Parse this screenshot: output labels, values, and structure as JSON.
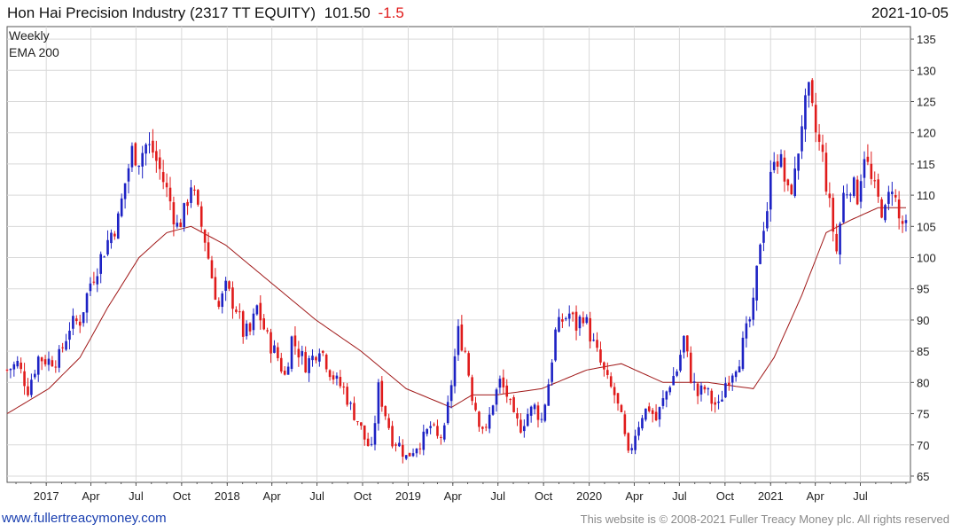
{
  "header": {
    "name": "Hon Hai Precision Industry (2317 TT EQUITY)",
    "price": "101.50",
    "change": "-1.5",
    "date": "2021-10-05"
  },
  "legend": {
    "period": "Weekly",
    "ema": "EMA 200"
  },
  "footer": {
    "link": "www.fullertreacymoney.com",
    "copyright": "This website is © 2008-2021 Fuller Treacy Money plc. All rights reserved"
  },
  "colors": {
    "up": "#1d22c4",
    "down": "#e01b1b",
    "ema": "#a01818",
    "title_name": "#111111",
    "grid": "#d9d9d9"
  },
  "chart_data": {
    "type": "candlestick",
    "interval": "weekly",
    "ylim": [
      64,
      137
    ],
    "y_ticks": [
      65,
      70,
      75,
      80,
      85,
      90,
      95,
      100,
      105,
      110,
      115,
      120,
      125,
      130,
      135
    ],
    "x_ticks": [
      {
        "label": "2017",
        "date": "2017-01-01"
      },
      {
        "label": "Apr",
        "date": "2017-04-01"
      },
      {
        "label": "Jul",
        "date": "2017-07-01"
      },
      {
        "label": "Oct",
        "date": "2017-10-01"
      },
      {
        "label": "2018",
        "date": "2018-01-01"
      },
      {
        "label": "Apr",
        "date": "2018-04-01"
      },
      {
        "label": "Jul",
        "date": "2018-07-01"
      },
      {
        "label": "Oct",
        "date": "2018-10-01"
      },
      {
        "label": "2019",
        "date": "2019-01-01"
      },
      {
        "label": "Apr",
        "date": "2019-04-01"
      },
      {
        "label": "Jul",
        "date": "2019-07-01"
      },
      {
        "label": "Oct",
        "date": "2019-10-01"
      },
      {
        "label": "2020",
        "date": "2020-01-01"
      },
      {
        "label": "Apr",
        "date": "2020-04-01"
      },
      {
        "label": "Jul",
        "date": "2020-07-01"
      },
      {
        "label": "Oct",
        "date": "2020-10-01"
      },
      {
        "label": "2021",
        "date": "2021-01-01"
      },
      {
        "label": "Apr",
        "date": "2021-04-01"
      },
      {
        "label": "Jul",
        "date": "2021-07-01"
      }
    ],
    "x_start": "2016-10-14",
    "x_end": "2021-10-10",
    "close_anchors": [
      [
        "2016-10-14",
        82
      ],
      [
        "2016-11-04",
        83
      ],
      [
        "2016-11-25",
        79
      ],
      [
        "2016-12-16",
        84
      ],
      [
        "2017-01-06",
        83.5
      ],
      [
        "2017-01-27",
        84
      ],
      [
        "2017-02-17",
        89
      ],
      [
        "2017-03-10",
        90
      ],
      [
        "2017-03-31",
        96
      ],
      [
        "2017-04-21",
        100
      ],
      [
        "2017-05-12",
        104
      ],
      [
        "2017-05-26",
        106
      ],
      [
        "2017-06-09",
        112
      ],
      [
        "2017-06-23",
        117
      ],
      [
        "2017-07-07",
        116
      ],
      [
        "2017-07-21",
        118
      ],
      [
        "2017-08-04",
        117
      ],
      [
        "2017-08-18",
        114
      ],
      [
        "2017-09-08",
        109
      ],
      [
        "2017-09-22",
        105
      ],
      [
        "2017-10-06",
        107
      ],
      [
        "2017-10-20",
        112
      ],
      [
        "2017-11-03",
        107
      ],
      [
        "2017-11-17",
        103
      ],
      [
        "2017-12-01",
        97
      ],
      [
        "2017-12-15",
        92
      ],
      [
        "2017-12-29",
        95
      ],
      [
        "2018-01-19",
        92
      ],
      [
        "2018-02-02",
        88
      ],
      [
        "2018-02-16",
        88
      ],
      [
        "2018-03-02",
        92
      ],
      [
        "2018-03-23",
        87
      ],
      [
        "2018-04-13",
        84
      ],
      [
        "2018-04-27",
        81
      ],
      [
        "2018-05-11",
        87
      ],
      [
        "2018-05-25",
        85
      ],
      [
        "2018-06-08",
        83
      ],
      [
        "2018-06-22",
        84
      ],
      [
        "2018-07-06",
        86
      ],
      [
        "2018-07-27",
        82
      ],
      [
        "2018-08-10",
        80
      ],
      [
        "2018-08-24",
        79
      ],
      [
        "2018-09-07",
        76
      ],
      [
        "2018-09-21",
        74
      ],
      [
        "2018-10-05",
        71
      ],
      [
        "2018-10-19",
        69
      ],
      [
        "2018-11-02",
        79
      ],
      [
        "2018-11-16",
        75
      ],
      [
        "2018-11-30",
        71
      ],
      [
        "2018-12-14",
        70
      ],
      [
        "2018-12-28",
        68
      ],
      [
        "2019-01-18",
        70
      ],
      [
        "2019-02-01",
        71
      ],
      [
        "2019-02-15",
        73
      ],
      [
        "2019-03-01",
        71
      ],
      [
        "2019-03-15",
        72
      ],
      [
        "2019-03-29",
        80
      ],
      [
        "2019-04-12",
        88
      ],
      [
        "2019-04-26",
        85
      ],
      [
        "2019-05-10",
        78
      ],
      [
        "2019-05-24",
        74
      ],
      [
        "2019-06-07",
        72
      ],
      [
        "2019-06-21",
        77
      ],
      [
        "2019-07-05",
        80
      ],
      [
        "2019-07-19",
        78
      ],
      [
        "2019-08-02",
        74
      ],
      [
        "2019-08-16",
        73
      ],
      [
        "2019-08-30",
        75
      ],
      [
        "2019-09-13",
        76
      ],
      [
        "2019-09-27",
        74
      ],
      [
        "2019-10-11",
        80
      ],
      [
        "2019-10-25",
        88
      ],
      [
        "2019-11-08",
        90
      ],
      [
        "2019-11-22",
        91
      ],
      [
        "2019-12-06",
        89
      ],
      [
        "2019-12-20",
        91
      ],
      [
        "2020-01-10",
        86
      ],
      [
        "2020-01-24",
        83
      ],
      [
        "2020-02-07",
        80
      ],
      [
        "2020-02-21",
        78
      ],
      [
        "2020-03-06",
        74
      ],
      [
        "2020-03-20",
        68
      ],
      [
        "2020-04-03",
        72
      ],
      [
        "2020-04-17",
        75
      ],
      [
        "2020-05-01",
        76
      ],
      [
        "2020-05-15",
        74
      ],
      [
        "2020-05-29",
        77
      ],
      [
        "2020-06-12",
        80
      ],
      [
        "2020-06-26",
        82
      ],
      [
        "2020-07-10",
        87
      ],
      [
        "2020-07-24",
        81
      ],
      [
        "2020-08-07",
        78
      ],
      [
        "2020-08-21",
        79
      ],
      [
        "2020-09-04",
        77
      ],
      [
        "2020-09-18",
        76
      ],
      [
        "2020-10-02",
        80
      ],
      [
        "2020-10-16",
        82
      ],
      [
        "2020-10-30",
        84
      ],
      [
        "2020-11-13",
        88
      ],
      [
        "2020-11-27",
        92
      ],
      [
        "2020-12-11",
        103
      ],
      [
        "2020-12-25",
        108
      ],
      [
        "2021-01-08",
        117
      ],
      [
        "2021-01-22",
        115
      ],
      [
        "2021-02-05",
        110
      ],
      [
        "2021-02-19",
        113
      ],
      [
        "2021-03-05",
        122
      ],
      [
        "2021-03-19",
        126
      ],
      [
        "2021-04-02",
        120
      ],
      [
        "2021-04-16",
        116
      ],
      [
        "2021-04-30",
        108
      ],
      [
        "2021-05-14",
        101
      ],
      [
        "2021-05-28",
        110
      ],
      [
        "2021-06-11",
        112
      ],
      [
        "2021-06-25",
        110
      ],
      [
        "2021-07-09",
        117
      ],
      [
        "2021-07-23",
        112
      ],
      [
        "2021-08-06",
        109
      ],
      [
        "2021-08-20",
        107
      ],
      [
        "2021-09-03",
        112
      ],
      [
        "2021-09-17",
        106
      ],
      [
        "2021-09-30",
        105
      ],
      [
        "2021-10-05",
        101.5
      ]
    ],
    "ema_anchors": [
      [
        "2016-10-14",
        75
      ],
      [
        "2017-01-06",
        79
      ],
      [
        "2017-03-10",
        84
      ],
      [
        "2017-05-05",
        92
      ],
      [
        "2017-07-07",
        100
      ],
      [
        "2017-09-01",
        104
      ],
      [
        "2017-10-20",
        105
      ],
      [
        "2017-12-29",
        102
      ],
      [
        "2018-03-30",
        96
      ],
      [
        "2018-06-29",
        90
      ],
      [
        "2018-09-28",
        85
      ],
      [
        "2018-12-28",
        79
      ],
      [
        "2019-03-29",
        76
      ],
      [
        "2019-05-10",
        78
      ],
      [
        "2019-06-28",
        78
      ],
      [
        "2019-09-27",
        79
      ],
      [
        "2019-12-27",
        82
      ],
      [
        "2020-03-06",
        83
      ],
      [
        "2020-05-29",
        80
      ],
      [
        "2020-08-28",
        80
      ],
      [
        "2020-11-27",
        79
      ],
      [
        "2021-01-08",
        84
      ],
      [
        "2021-03-05",
        94
      ],
      [
        "2021-04-23",
        104
      ],
      [
        "2021-06-11",
        106
      ],
      [
        "2021-08-06",
        108
      ],
      [
        "2021-10-05",
        108
      ]
    ]
  }
}
